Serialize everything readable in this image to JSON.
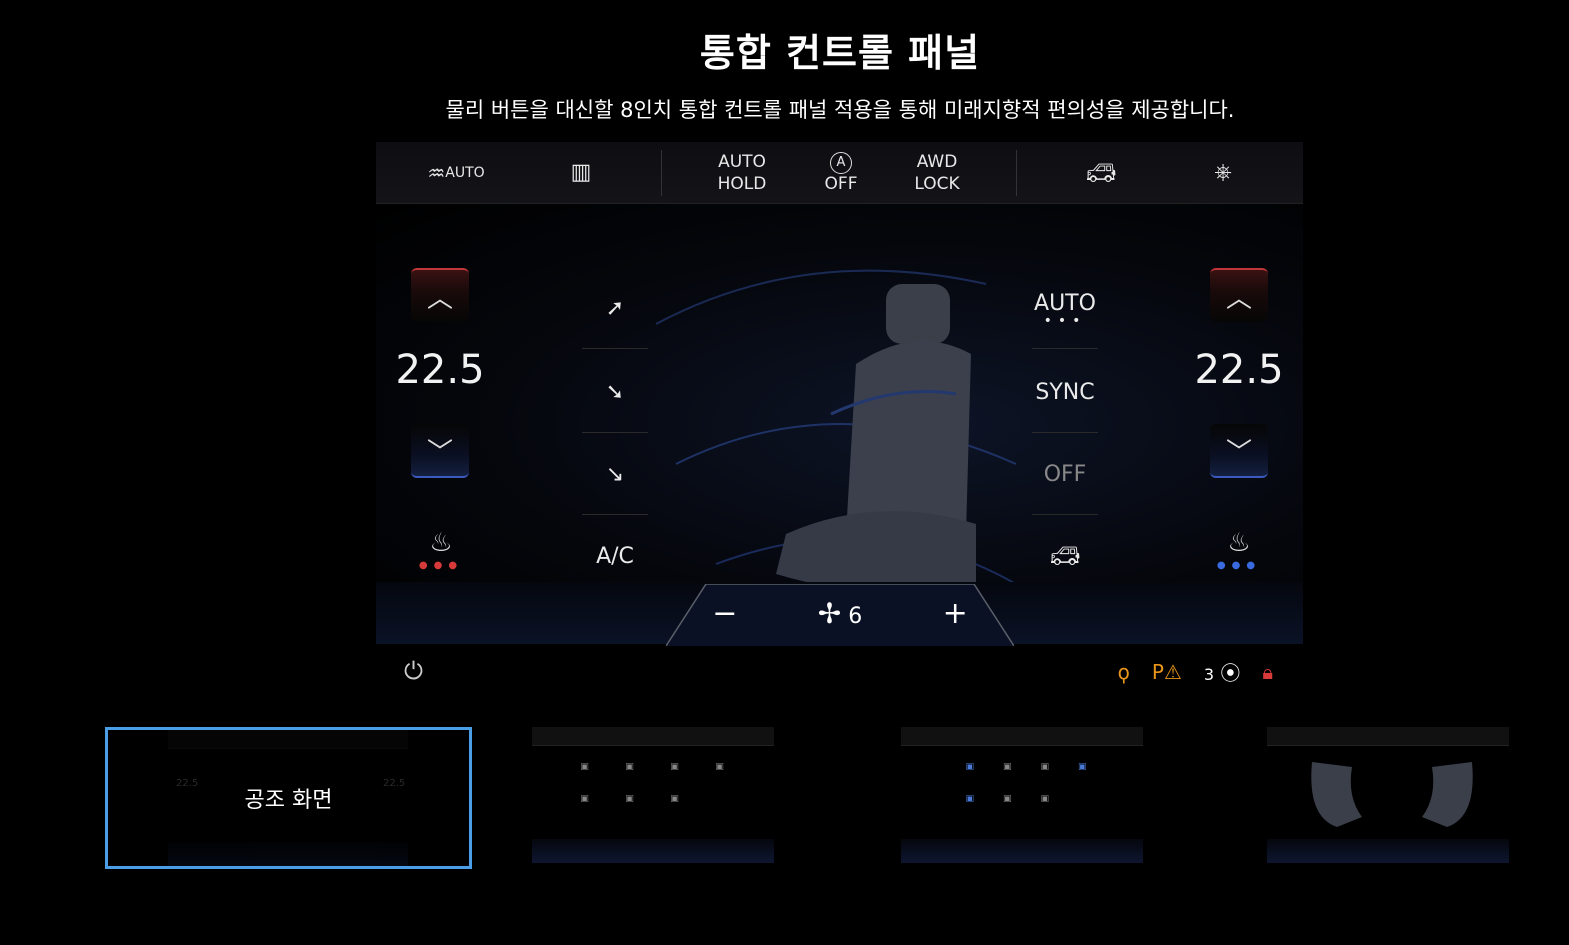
{
  "header": {
    "title": "통합 컨트롤 패널",
    "subtitle": "물리 버튼을 대신할 8인치 통합 컨트롤 패널 적용을 통해 미래지향적 편의성을 제공합니다."
  },
  "topbar": {
    "front_defrost_label": "AUTO",
    "auto_hold_label": "AUTO\nHOLD",
    "auto_off_icon_letter": "A",
    "auto_off_label": "OFF",
    "awd_lock_label": "AWD\nLOCK"
  },
  "climate": {
    "left_temp": "22.5",
    "right_temp": "22.5",
    "ac_label": "A/C",
    "auto_label": "AUTO",
    "sync_label": "SYNC",
    "off_label": "OFF",
    "fan_minus": "−",
    "fan_plus": "+",
    "fan_speed": "6"
  },
  "status": {
    "lane_count": "3"
  },
  "thumbnails": {
    "active_label": "공조 화면",
    "mini_temp_left": "22.5",
    "mini_temp_right": "22.5"
  },
  "colors": {
    "accent_border": "#4a9ee8",
    "temp_up_red": "#c0363a",
    "temp_down_blue": "#3a5ac0",
    "status_orange": "#e8951a",
    "status_red": "#d83a3a"
  }
}
